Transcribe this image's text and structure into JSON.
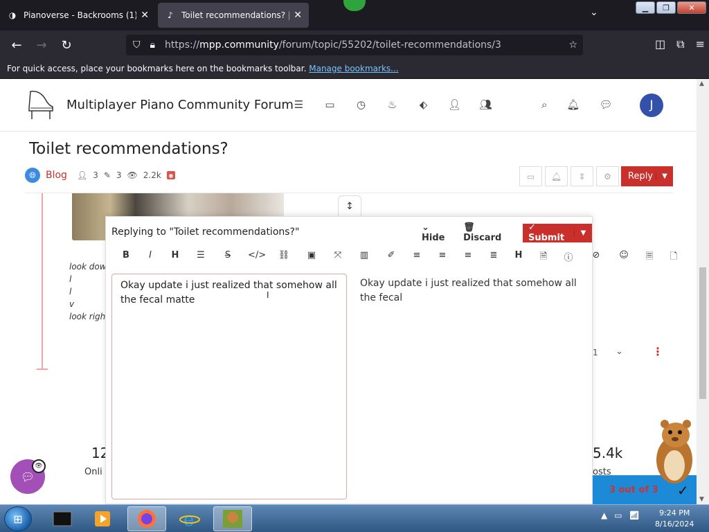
{
  "browser": {
    "tabs": [
      {
        "title": "Pianoverse - Backrooms (1)",
        "active": false
      },
      {
        "title": "Toilet recommendations? | mpp.",
        "active": true
      }
    ],
    "url_prefix": "https://",
    "url_host": "mpp.community",
    "url_path": "/forum/topic/55202/toilet-recommendations/3",
    "bookmarks_text": "For quick access, place your bookmarks here on the bookmarks toolbar.",
    "bookmarks_link": "Manage bookmarks..."
  },
  "site": {
    "title": "Multiplayer Piano Community Forum",
    "avatar_letter": "J"
  },
  "topic": {
    "title": "Toilet recommendations?",
    "category": "Blog",
    "posters": "3",
    "posts": "3",
    "views": "2.2k",
    "reply_label": "Reply"
  },
  "post": {
    "lines": [
      "look dow",
      "l",
      "l",
      "v",
      "look righ"
    ],
    "page_num": "1"
  },
  "stats": {
    "left_count": "12",
    "left_label": "Onli",
    "right_count": "5.4k",
    "right_label": "osts"
  },
  "composer": {
    "title": "Replying to \"Toilet recommendations?\"",
    "hide_label": "Hide",
    "discard_label": "Discard",
    "submit_label": "Submit",
    "editor_text": "Okay update i just realized that somehow all the fecal matte",
    "preview_text": "Okay update i just realized that somehow all the fecal"
  },
  "bonzi": {
    "progress_text": "3 out of 3"
  },
  "taskbar": {
    "time": "9:24 PM",
    "date": "8/16/2024"
  },
  "colors": {
    "accent": "#c9302c",
    "browser_dark": "#1c1b22",
    "chat_purple": "#a34fb8"
  }
}
